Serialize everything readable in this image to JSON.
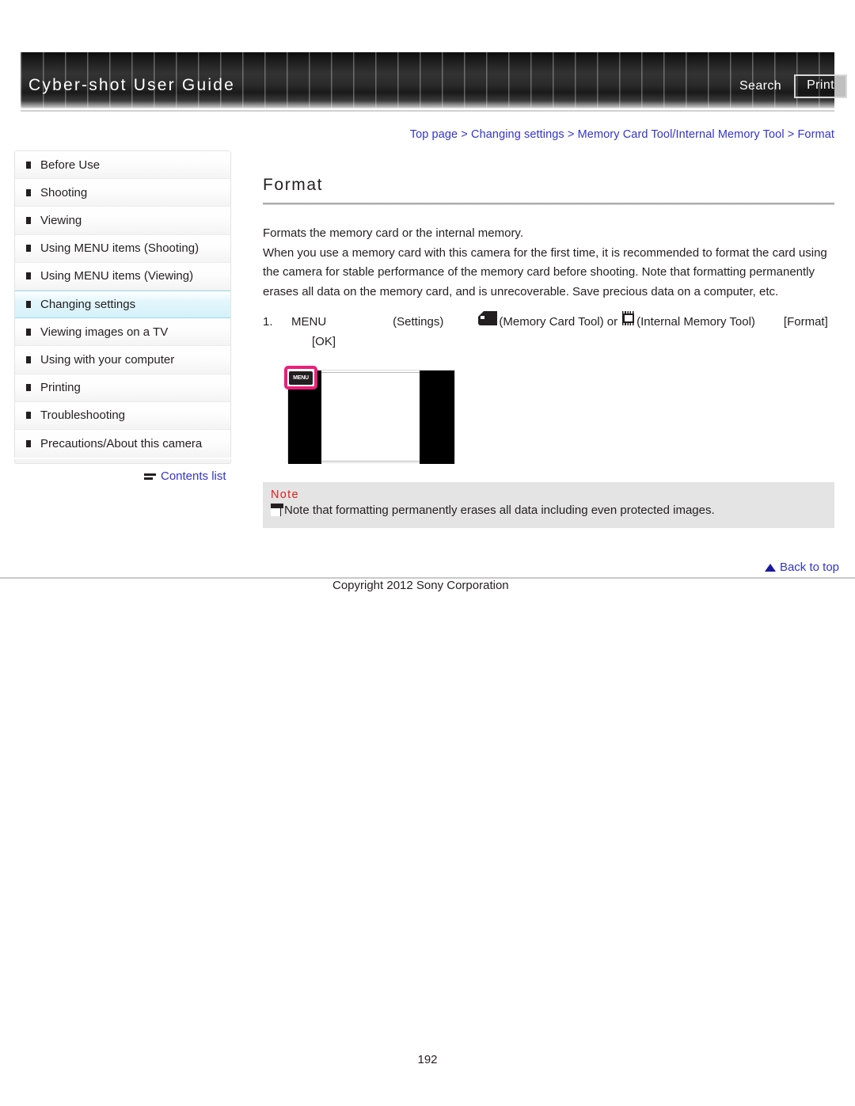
{
  "header": {
    "title": "Cyber-shot User Guide",
    "search_label": "Search",
    "print_label": "Print"
  },
  "breadcrumb": {
    "text": "Top page > Changing settings > Memory Card Tool/Internal Memory Tool > Format"
  },
  "sidebar": {
    "items": [
      {
        "label": "Before Use",
        "selected": false
      },
      {
        "label": "Shooting",
        "selected": false
      },
      {
        "label": "Viewing",
        "selected": false
      },
      {
        "label": "Using MENU items (Shooting)",
        "selected": false
      },
      {
        "label": "Using MENU items (Viewing)",
        "selected": false
      },
      {
        "label": "Changing settings",
        "selected": true
      },
      {
        "label": "Viewing images on a TV",
        "selected": false
      },
      {
        "label": "Using with your computer",
        "selected": false
      },
      {
        "label": "Printing",
        "selected": false
      },
      {
        "label": "Troubleshooting",
        "selected": false
      },
      {
        "label": "Precautions/About this camera",
        "selected": false
      }
    ],
    "contents_list_label": "Contents list"
  },
  "main": {
    "title": "Format",
    "paragraphs": [
      "Formats the memory card or the internal memory.",
      "When you use a memory card with this camera for the first time, it is recommended to format the card using the camera for stable performance of the memory card before shooting. Note that formatting permanently erases all data on the memory card, and is unrecoverable. Save precious data on a computer, etc."
    ],
    "step": {
      "number": "1.",
      "menu_label": "MENU",
      "settings_label": "(Settings)",
      "memory_card_label": "(Memory Card Tool) or",
      "internal_memory_label": "(Internal Memory Tool)",
      "format_label": "[Format]",
      "ok_label": "[OK]"
    },
    "illustration": {
      "menu_button_label": "MENU",
      "highlight_color": "#ec1e79"
    }
  },
  "note": {
    "title": "Note",
    "text": "Note that formatting permanently erases all data including even protected images."
  },
  "footer": {
    "back_to_top_label": "Back to top",
    "copyright": "Copyright 2012 Sony Corporation",
    "page_number": "192"
  }
}
